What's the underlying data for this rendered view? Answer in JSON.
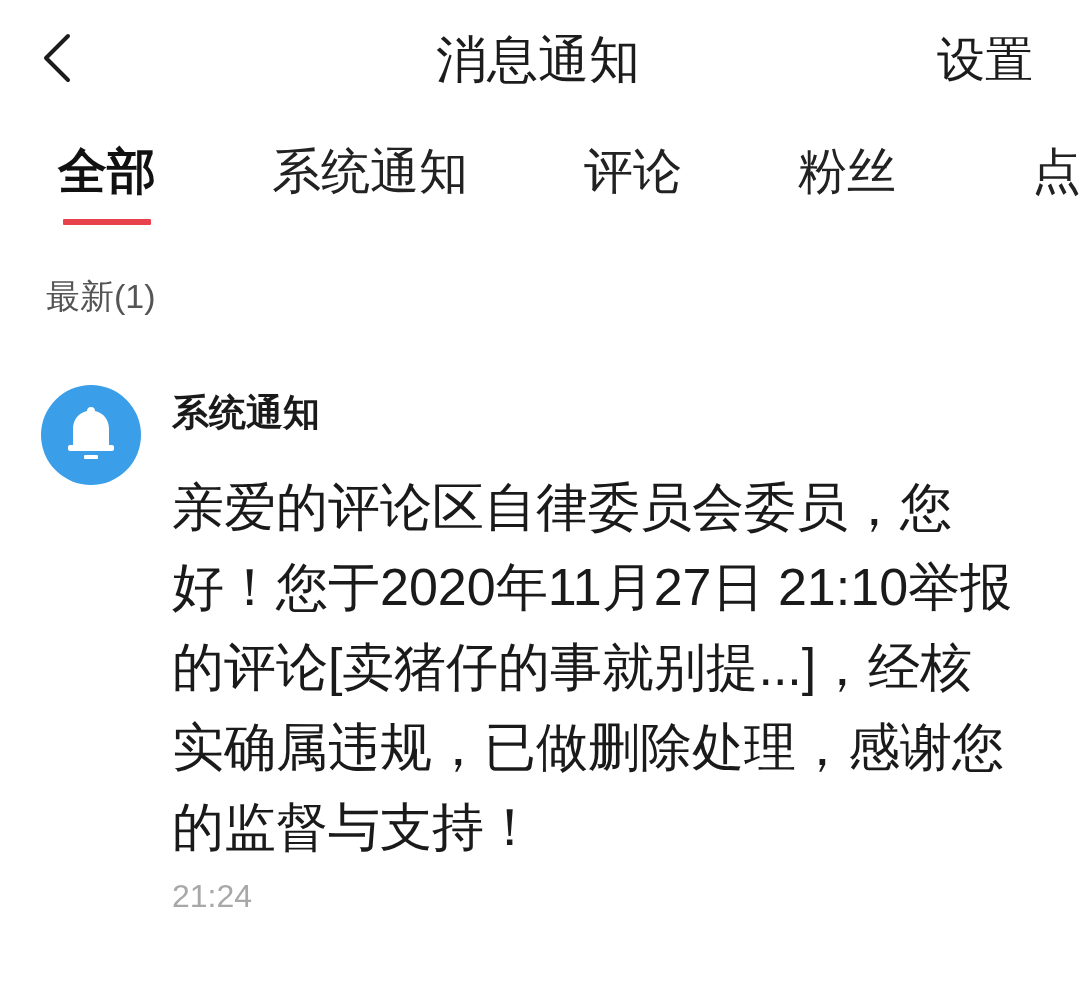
{
  "header": {
    "title": "消息通知",
    "action": "设置"
  },
  "tabs": [
    {
      "label": "全部",
      "selected": true
    },
    {
      "label": "系统通知",
      "selected": false
    },
    {
      "label": "评论",
      "selected": false
    },
    {
      "label": "粉丝",
      "selected": false
    },
    {
      "label": "点",
      "selected": false
    }
  ],
  "section": {
    "label": "最新(1)"
  },
  "notifications": [
    {
      "sender": "系统通知",
      "message": "亲爱的评论区自律委员会委员，您好！您于2020年11月27日 21:10举报的评论[卖猪仔的事就别提...]，经核实确属违规，已做删除处理，感谢您的监督与支持！",
      "time": "21:24"
    }
  ]
}
